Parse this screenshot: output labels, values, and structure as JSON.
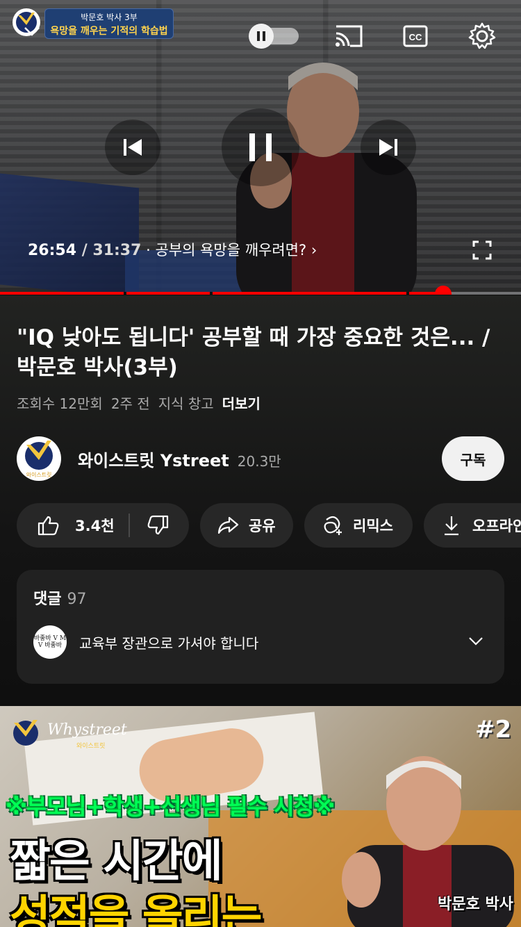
{
  "player": {
    "overlay_badge": {
      "line1": "박문호 박사 3부",
      "line2": "욕망을 깨우는 기적의 학습법"
    },
    "current_time": "26:54",
    "total_time": " / 31:37",
    "chapter_label": " · 공부의 욕망을 깨우려면? ›",
    "progress_fraction": 0.85,
    "chapter_markers": [
      0.24,
      0.405,
      0.783
    ],
    "accent_color": "#ff0000"
  },
  "video": {
    "title": "\"IQ 낮아도 됩니다' 공부할 때 가장 중요한 것은... / 박문호 박사(3부)",
    "views": "조회수 12만회",
    "age": "2주 전",
    "tag": "지식 창고",
    "more": "더보기"
  },
  "channel": {
    "name": "와이스트릿 Ystreet",
    "subscribers": "20.3만",
    "subscribe_label": "구독",
    "avatar_text": "와이스트릿"
  },
  "actions": {
    "likes": "3.4천",
    "share": "공유",
    "remix": "리믹스",
    "offline": "오프라인"
  },
  "comments": {
    "label": "댓글",
    "count": "97",
    "top_comment": "교육부 장관으로 가셔야 합니다",
    "avatar_text": "바좋바 V M V 바좋바"
  },
  "next_video": {
    "brand": "Whystreet",
    "brand_sub": "와이스트릿",
    "episode": "#2",
    "tagline": "※부모님+학생+선생님 필수 시청※",
    "headline1": "짧은 시간에",
    "headline2": "성적을 올리는",
    "name_tag": "박문호 박사"
  }
}
